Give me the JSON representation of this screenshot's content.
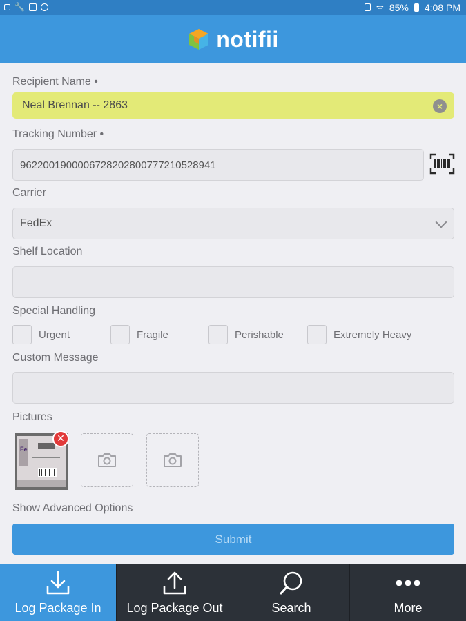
{
  "status_bar": {
    "battery": "85%",
    "time": "4:08 PM"
  },
  "header": {
    "app_name": "notifii"
  },
  "form": {
    "recipient": {
      "label": "Recipient Name •",
      "value": "Neal Brennan -- 2863"
    },
    "tracking": {
      "label": "Tracking Number •",
      "value": "9622001900006728202800777210528941"
    },
    "carrier": {
      "label": "Carrier",
      "value": "FedEx"
    },
    "shelf": {
      "label": "Shelf Location",
      "value": ""
    },
    "special_handling": {
      "label": "Special Handling",
      "options": [
        "Urgent",
        "Fragile",
        "Perishable",
        "Extremely Heavy"
      ]
    },
    "custom_message": {
      "label": "Custom Message",
      "value": ""
    },
    "pictures": {
      "label": "Pictures"
    },
    "advanced_label": "Show Advanced Options",
    "submit_label": "Submit"
  },
  "bottom_nav": [
    {
      "label": "Log Package In",
      "icon": "download-icon"
    },
    {
      "label": "Log Package Out",
      "icon": "upload-icon"
    },
    {
      "label": "Search",
      "icon": "search-icon"
    },
    {
      "label": "More",
      "icon": "more-icon"
    }
  ]
}
